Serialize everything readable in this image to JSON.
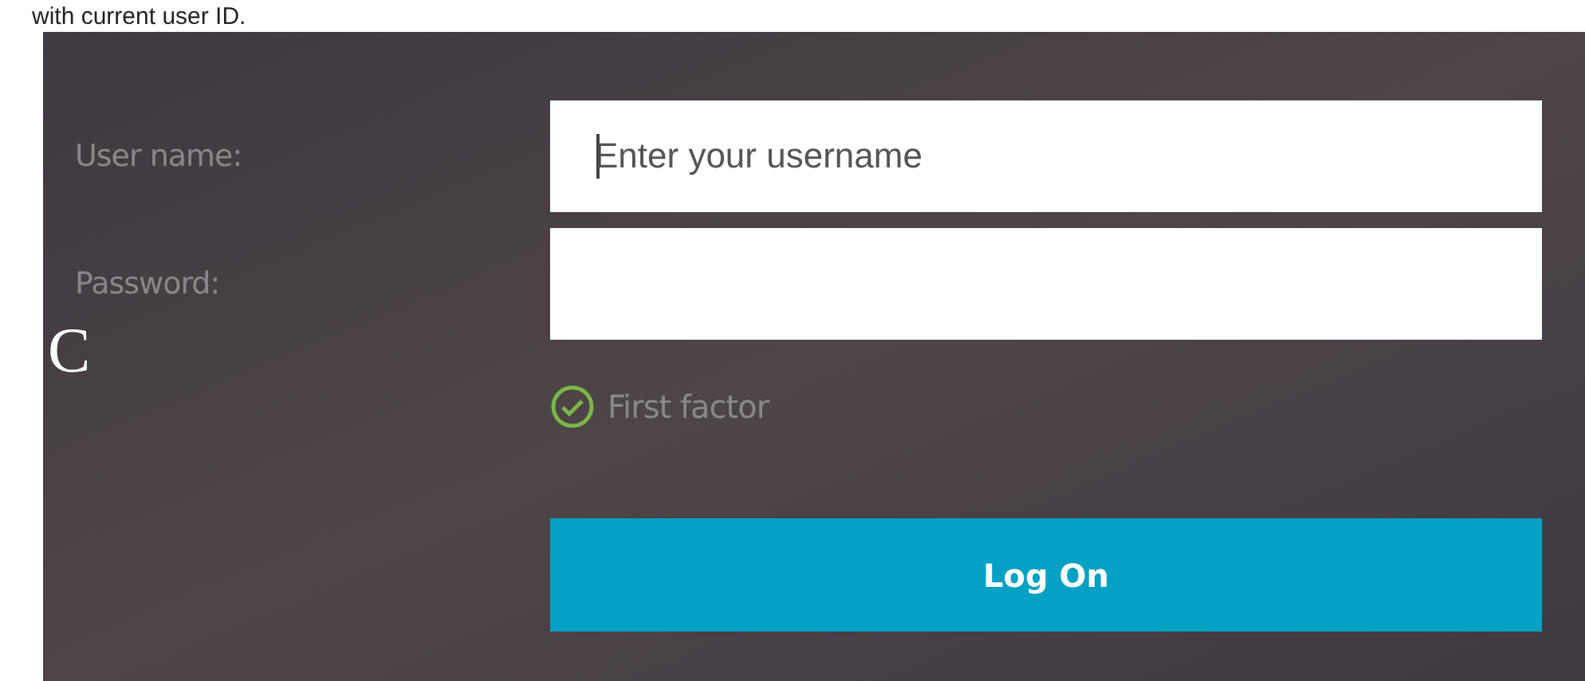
{
  "caption": "with current user ID.",
  "logo_letter": "C",
  "fields": [
    {
      "label": "User name:",
      "placeholder": "Enter your username",
      "focused": true
    },
    {
      "label": "Password:",
      "focused": false
    }
  ],
  "factor": {
    "label": "First factor",
    "done": true
  },
  "button": "Log On"
}
